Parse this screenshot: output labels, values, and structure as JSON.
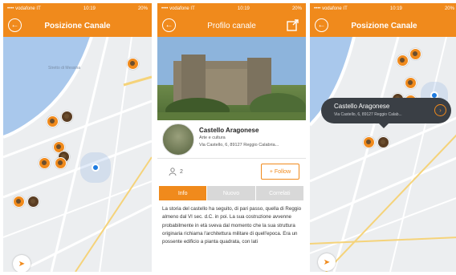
{
  "status_bar": {
    "carrier": "•••• vodafone IT",
    "time": "10:19",
    "battery": "20%"
  },
  "screens": [
    {
      "nav_title": "Posizione Canale"
    },
    {
      "nav_title": "Profilo canale"
    },
    {
      "nav_title": "Posizione Canale"
    }
  ],
  "map": {
    "labels": [
      "Stretto di Messina"
    ],
    "user_location_color": "#1e7be0"
  },
  "profile": {
    "title": "Castello Aragonese",
    "category": "Arte e cultura",
    "address": "Via Castello, 6, 89127 Reggio Calabria...",
    "followers": "2",
    "follow_label": "+ Follow",
    "tabs": [
      "Info",
      "Nuovo",
      "Correlati"
    ],
    "active_tab": "Info",
    "description": "La storia del castello ha seguito, di pari passo, quella di Reggio almeno dal VI sec. d.C. in poi. La sua costruzione avvenne probabilmente in età sveva dal momento che la sua struttura originaria richiama l'architettura militare di quell'epoca. Era un possente edificio a pianta quadrata, con lati"
  },
  "popup": {
    "title": "Castello Aragonese",
    "address": "Via Castello, 6, 89127 Reggio Calab..."
  },
  "colors": {
    "accent": "#f08a1c",
    "popup_bg": "#3a3f45"
  }
}
